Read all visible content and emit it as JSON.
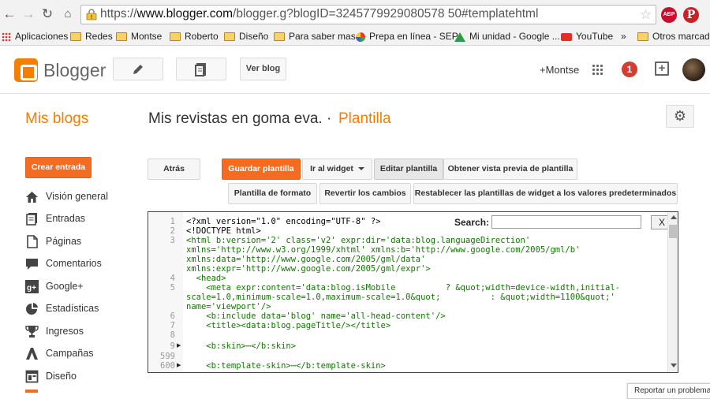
{
  "browser": {
    "url_prefix": "https://",
    "url_host": "www.blogger.com",
    "url_rest": "/blogger.g?blogID=3245779929080578 50#templatehtml",
    "bookmarks": [
      {
        "label": "Aplicaciones",
        "icon": "apps-grid-icon"
      },
      {
        "label": "Redes",
        "icon": "folder-icon"
      },
      {
        "label": "Montse",
        "icon": "folder-icon"
      },
      {
        "label": "Roberto",
        "icon": "folder-icon"
      },
      {
        "label": "Diseño",
        "icon": "folder-icon"
      },
      {
        "label": "Para saber mas",
        "icon": "folder-icon"
      },
      {
        "label": "Prepa en línea - SEP",
        "icon": "site-icon"
      },
      {
        "label": "Mi unidad - Google ...",
        "icon": "drive-icon"
      },
      {
        "label": "YouTube",
        "icon": "youtube-icon"
      },
      {
        "label": "»",
        "icon": ""
      },
      {
        "label": "Otros marcadores",
        "icon": "folder-icon"
      }
    ],
    "extensions": {
      "abp": "ABP",
      "pinterest": "P"
    }
  },
  "header": {
    "brand": "Blogger",
    "view_blog": "Ver blog",
    "user": "+Montse",
    "notifications": "1"
  },
  "page": {
    "section": "Mis blogs",
    "blog_name": "Mis revistas en goma eva.",
    "separator": "·",
    "page_name": "Plantilla"
  },
  "sidebar": {
    "create_label": "Crear entrada",
    "items": [
      {
        "label": "Visión general",
        "icon": "home-icon"
      },
      {
        "label": "Entradas",
        "icon": "posts-icon"
      },
      {
        "label": "Páginas",
        "icon": "pages-icon"
      },
      {
        "label": "Comentarios",
        "icon": "comments-icon"
      },
      {
        "label": "Google+",
        "icon": "google-plus-icon"
      },
      {
        "label": "Estadísticas",
        "icon": "stats-icon"
      },
      {
        "label": "Ingresos",
        "icon": "trophy-icon"
      },
      {
        "label": "Campañas",
        "icon": "campaigns-icon"
      },
      {
        "label": "Diseño",
        "icon": "layout-icon"
      }
    ]
  },
  "toolbar": {
    "back": "Atrás",
    "save": "Guardar plantilla",
    "goto_widget": "Ir al widget",
    "edit": "Editar plantilla",
    "preview": "Obtener vista previa de plantilla",
    "format": "Plantilla de formato",
    "revert": "Revertir los cambios",
    "reset_widgets": "Restablecer las plantillas de widget a los valores predeterminados"
  },
  "editor": {
    "search_label": "Search:",
    "search_value": "",
    "close_label": "X",
    "line_numbers": [
      "1",
      "2",
      "3",
      "",
      "",
      "",
      "4",
      "5",
      "",
      "",
      "6",
      "7",
      "8",
      "9",
      "599",
      "600"
    ],
    "lines": [
      "<?xml version=\"1.0\" encoding=\"UTF-8\" ?>",
      "<!DOCTYPE html>",
      "<html b:version='2' class='v2' expr:dir='data:blog.languageDirection'",
      "xmlns='http://www.w3.org/1999/xhtml' xmlns:b='http://www.google.com/2005/gml/b'",
      "xmlns:data='http://www.google.com/2005/gml/data'",
      "xmlns:expr='http://www.google.com/2005/gml/expr'>",
      "  <head>",
      "    <meta expr:content='data:blog.isMobile          ? &quot;width=device-width,initial-",
      "scale=1.0,minimum-scale=1.0,maximum-scale=1.0&quot;          : &quot;width=1100&quot;'",
      "name='viewport'/>",
      "    <b:include data='blog' name='all-head-content'/>",
      "    <title><data:blog.pageTitle/></title>",
      "",
      "    <b:skin>⋯</b:skin>",
      "",
      "    <b:template-skin>⋯</b:template-skin>"
    ]
  },
  "footer": {
    "report": "Reportar un problema"
  }
}
